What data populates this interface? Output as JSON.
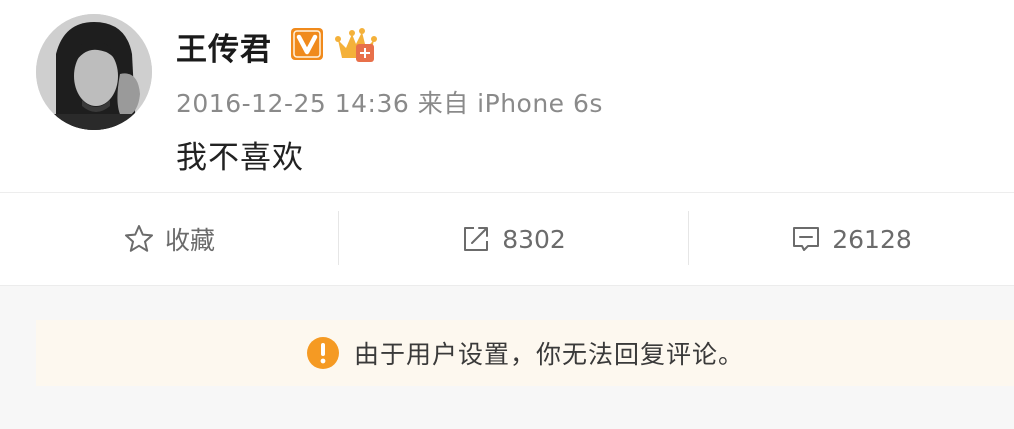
{
  "post": {
    "username": "王传君",
    "meta": "2016-12-25 14:36 来自 iPhone 6s",
    "content": "我不喜欢"
  },
  "actions": {
    "favorite_label": "收藏",
    "repost_count": "8302",
    "comment_count": "26128"
  },
  "notice": {
    "text": "由于用户设置，你无法回复评论。"
  },
  "colors": {
    "badge_orange": "#f08a1c",
    "warning_orange": "#f59a23",
    "notice_bg": "#fdf8ef"
  },
  "icons": {
    "avatar": "avatar",
    "verified_badge": "verified-v-icon",
    "member_badge": "crown-icon",
    "favorite": "star-icon",
    "repost": "share-icon",
    "comment": "comment-icon",
    "warning": "warning-icon"
  }
}
